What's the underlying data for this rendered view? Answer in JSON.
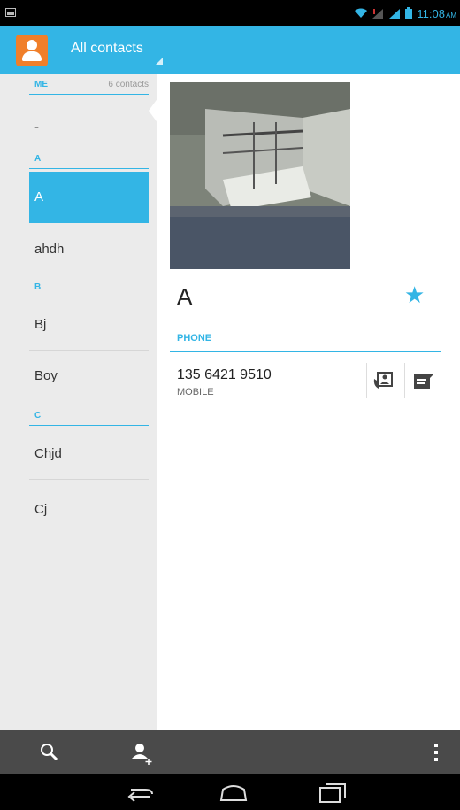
{
  "status_bar": {
    "time": "11:08",
    "ampm": "AM",
    "icons": [
      "image-icon",
      "wifi-icon",
      "signal-icon",
      "signal-icon",
      "battery-icon"
    ]
  },
  "action_bar": {
    "title": "All contacts",
    "app_icon": "contacts-icon"
  },
  "contact_list": {
    "me_header": "ME",
    "count": "6 contacts",
    "me_entry": "-",
    "sections": [
      {
        "letter": "A",
        "contacts": [
          "A",
          "ahdh"
        ]
      },
      {
        "letter": "B",
        "contacts": [
          "Bj",
          "Boy"
        ]
      },
      {
        "letter": "C",
        "contacts": [
          "Chjd",
          "Cj"
        ]
      }
    ],
    "selected": "A"
  },
  "detail": {
    "name": "A",
    "favorite_icon": "star-icon",
    "phone_header": "PHONE",
    "phone_number": "135 6421 9510",
    "phone_type": "MOBILE"
  },
  "toolbar": {
    "icons": [
      "search-icon",
      "add-contact-icon",
      "overflow-menu-icon"
    ]
  },
  "nav": {
    "icons": [
      "back-icon",
      "home-icon",
      "recent-apps-icon"
    ]
  },
  "colors": {
    "accent": "#33b5e5",
    "app_icon": "#f07f2a",
    "toolbar": "#4a4a4a",
    "list_bg": "#ebebeb"
  }
}
